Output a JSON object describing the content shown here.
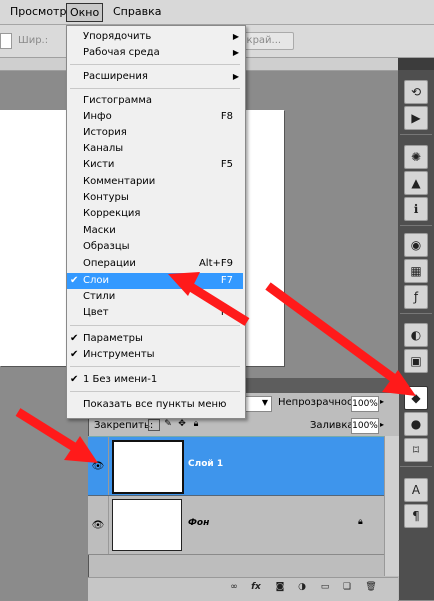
{
  "menubar": {
    "items": [
      {
        "label": "Просмотр"
      },
      {
        "label": "Окно"
      },
      {
        "label": "Справка"
      }
    ]
  },
  "options_bar": {
    "width_label": "Шир.:",
    "button_label": "...край..."
  },
  "window_menu": {
    "items": [
      {
        "label": "Упорядочить",
        "shortcut": "",
        "submenu": true,
        "checked": false
      },
      {
        "label": "Рабочая среда",
        "shortcut": "",
        "submenu": true,
        "checked": false
      },
      {
        "label": "Расширения",
        "shortcut": "",
        "submenu": true,
        "checked": false
      },
      {
        "label": "Гистограмма",
        "shortcut": "",
        "checked": false
      },
      {
        "label": "Инфо",
        "shortcut": "F8",
        "checked": false
      },
      {
        "label": "История",
        "shortcut": "",
        "checked": false
      },
      {
        "label": "Каналы",
        "shortcut": "",
        "checked": false
      },
      {
        "label": "Кисти",
        "shortcut": "F5",
        "checked": false
      },
      {
        "label": "Комментарии",
        "shortcut": "",
        "checked": false
      },
      {
        "label": "Контуры",
        "shortcut": "",
        "checked": false
      },
      {
        "label": "Коррекция",
        "shortcut": "",
        "checked": false
      },
      {
        "label": "Маски",
        "shortcut": "",
        "checked": false
      },
      {
        "label": "Образцы",
        "shortcut": "",
        "checked": false
      },
      {
        "label": "Операции",
        "shortcut": "Alt+F9",
        "checked": false
      },
      {
        "label": "Слои",
        "shortcut": "F7",
        "checked": true,
        "selected": true
      },
      {
        "label": "Стили",
        "shortcut": "",
        "checked": false
      },
      {
        "label": "Цвет",
        "shortcut": "F6",
        "checked": false
      },
      {
        "label": "Параметры",
        "shortcut": "",
        "checked": true
      },
      {
        "label": "Инструменты",
        "shortcut": "",
        "checked": true
      },
      {
        "label": "1 Без имени-1",
        "shortcut": "",
        "checked": true
      },
      {
        "label": "Показать все пункты меню",
        "shortcut": "",
        "checked": false
      }
    ]
  },
  "layers_panel": {
    "opacity_label": "Непрозрачность:",
    "opacity_value": "100%",
    "lock_label": "Закрепить:",
    "fill_label": "Заливка:",
    "fill_value": "100%",
    "layers": [
      {
        "name": "Слой 1",
        "selected": true,
        "visible": true
      },
      {
        "name": "Фон",
        "selected": false,
        "visible": true,
        "locked": true
      }
    ],
    "footer_icons": [
      "link-icon",
      "fx-icon",
      "mask-icon",
      "adjustment-icon",
      "group-icon",
      "new-layer-icon",
      "trash-icon"
    ]
  },
  "dock_icons": [
    "history-icon",
    "actions-play-icon",
    "navigator-icon",
    "histogram-icon",
    "info-icon",
    "swatches-icon",
    "grid-icon",
    "styles-fx-icon",
    "adjustments-icon",
    "masks-icon",
    "layers-icon",
    "channels-icon",
    "paths-icon",
    "character-icon",
    "paragraph-icon"
  ],
  "colors": {
    "accent": "#3399ff",
    "selected_layer": "#3e95ec",
    "annotation_arrow": "#ff1a1a"
  }
}
